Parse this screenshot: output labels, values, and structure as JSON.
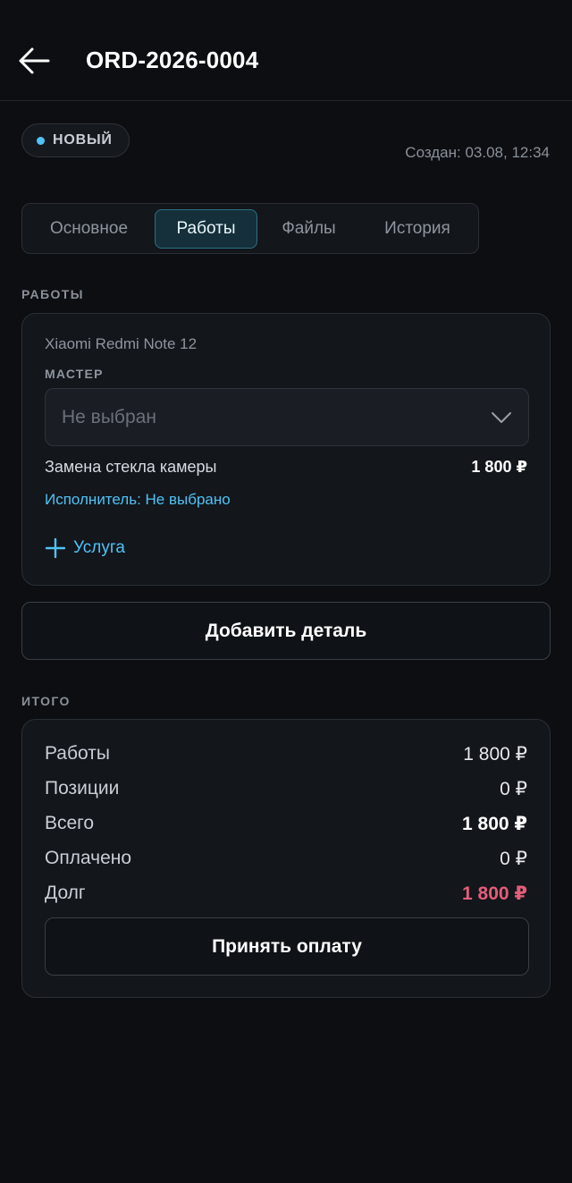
{
  "header": {
    "title": "ORD-2026-0004",
    "back_icon": "arrow-left-icon"
  },
  "status": {
    "label": "НОВЫЙ",
    "dot_color": "#4fc3f7"
  },
  "created": "Создан: 03.08, 12:34",
  "tabs": [
    {
      "label": "Основное",
      "active": false
    },
    {
      "label": "Работы",
      "active": true
    },
    {
      "label": "Файлы",
      "active": false
    },
    {
      "label": "История",
      "active": false
    }
  ],
  "works_section": {
    "label": "РАБОТЫ",
    "device": "Xiaomi Redmi Note 12",
    "master_label": "МАСТЕР",
    "master_placeholder": "Не выбран",
    "service": {
      "name": "Замена стекла камеры",
      "price": "1 800 ₽"
    },
    "performer": "Исполнитель: Не выбрано",
    "add_service": "Услуга"
  },
  "add_part_button": "Добавить деталь",
  "totals": {
    "label": "ИТОГО",
    "rows": [
      {
        "label": "Работы",
        "value": "1 800 ₽"
      },
      {
        "label": "Позиции",
        "value": "0 ₽"
      },
      {
        "label": "Всего",
        "value": "1 800 ₽"
      },
      {
        "label": "Оплачено",
        "value": "0 ₽"
      },
      {
        "label": "Долг",
        "value": "1 800 ₽"
      }
    ],
    "accept_payment": "Принять оплату"
  },
  "colors": {
    "accent": "#4fc3f7",
    "debt": "#e35d7a",
    "background": "#0c0e12"
  }
}
